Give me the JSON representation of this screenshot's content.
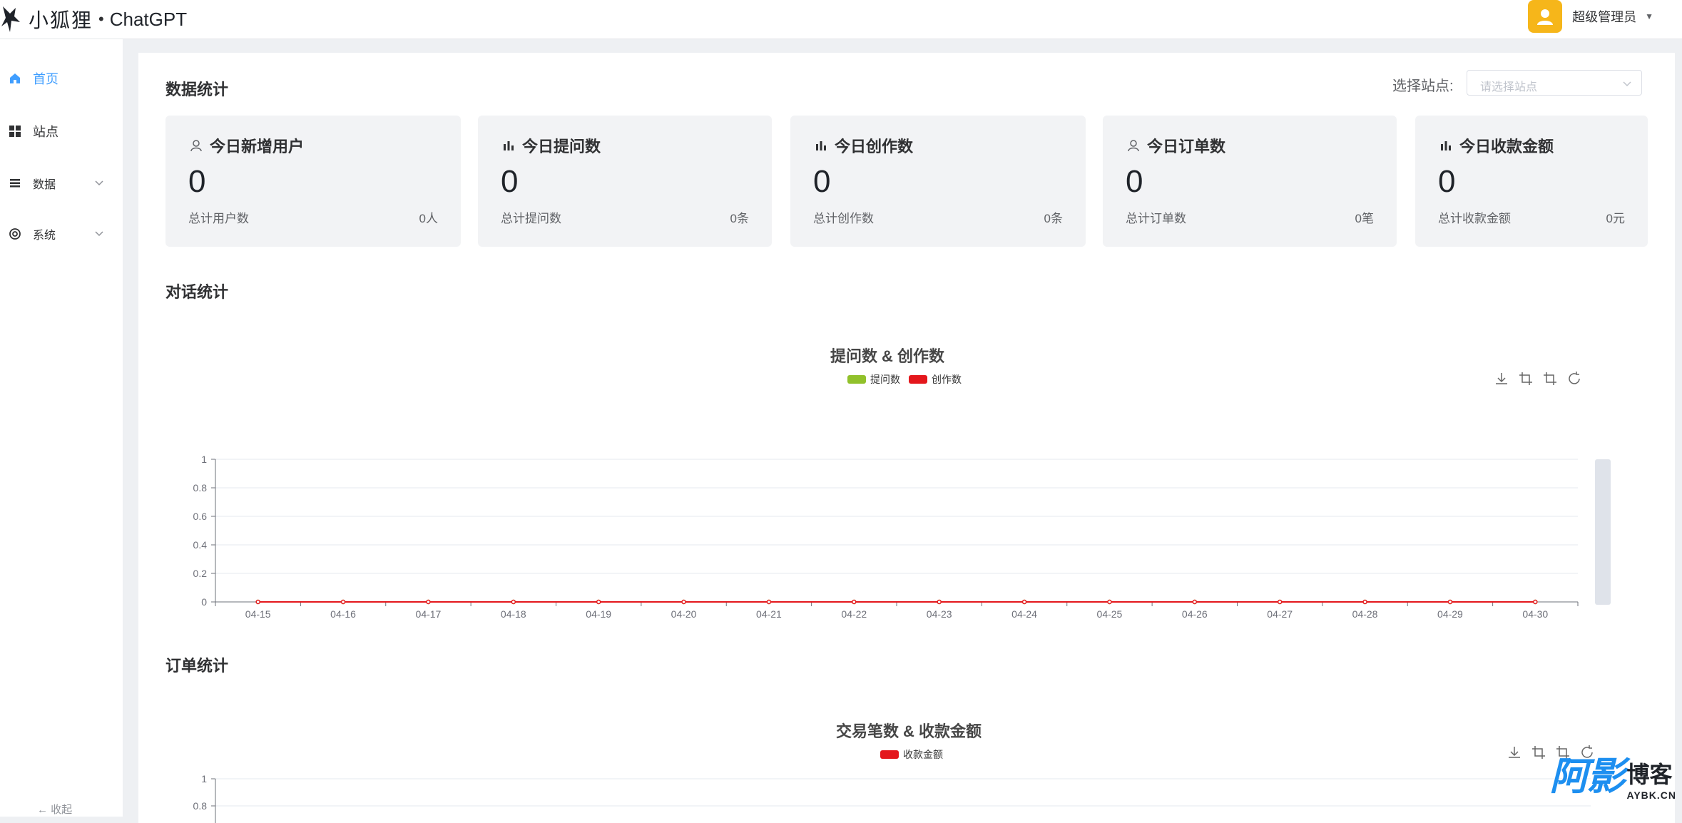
{
  "header": {
    "logo_text": "小狐狸",
    "logo_dot": "•",
    "logo_sub": "ChatGPT",
    "user_name": "超级管理员",
    "user_caret": "▼"
  },
  "sidebar": {
    "items": [
      {
        "label": "首页",
        "icon": "home-icon",
        "active": true
      },
      {
        "label": "站点",
        "icon": "grid-icon",
        "active": false
      },
      {
        "label": "数据",
        "icon": "list-icon",
        "active": false,
        "expandable": true
      },
      {
        "label": "系统",
        "icon": "gear-icon",
        "active": false,
        "expandable": true
      }
    ],
    "collapse_label": "← 收起"
  },
  "main": {
    "stats_title": "数据统计",
    "site_select_label": "选择站点:",
    "site_select_placeholder": "请选择站点",
    "cards": [
      {
        "title": "今日新增用户",
        "icon": "user-icon",
        "value": "0",
        "foot": "总计用户数",
        "total": "0人"
      },
      {
        "title": "今日提问数",
        "icon": "bar-chart-icon",
        "value": "0",
        "foot": "总计提问数",
        "total": "0条"
      },
      {
        "title": "今日创作数",
        "icon": "bar-chart-icon",
        "value": "0",
        "foot": "总计创作数",
        "total": "0条"
      },
      {
        "title": "今日订单数",
        "icon": "user-icon",
        "value": "0",
        "foot": "总计订单数",
        "total": "0笔"
      },
      {
        "title": "今日收款金额",
        "icon": "bar-chart-icon",
        "value": "0",
        "foot": "总计收款金额",
        "total": "0元"
      }
    ],
    "dialog_section_title": "对话统计",
    "order_section_title": "订单统计"
  },
  "accent_colors": {
    "primary": "#409eff",
    "series_green": "#91c12b",
    "series_red": "#e4171c",
    "avatar": "#f6b61a"
  },
  "chart_data": [
    {
      "type": "line",
      "title": "提问数 & 创作数",
      "x": [
        "04-15",
        "04-16",
        "04-17",
        "04-18",
        "04-19",
        "04-20",
        "04-21",
        "04-22",
        "04-23",
        "04-24",
        "04-25",
        "04-26",
        "04-27",
        "04-28",
        "04-29",
        "04-30"
      ],
      "series": [
        {
          "name": "提问数",
          "color": "#91c12b",
          "values": [
            0,
            0,
            0,
            0,
            0,
            0,
            0,
            0,
            0,
            0,
            0,
            0,
            0,
            0,
            0,
            0
          ]
        },
        {
          "name": "创作数",
          "color": "#e4171c",
          "values": [
            0,
            0,
            0,
            0,
            0,
            0,
            0,
            0,
            0,
            0,
            0,
            0,
            0,
            0,
            0,
            0
          ]
        }
      ],
      "y_ticks": [
        "0",
        "0.2",
        "0.4",
        "0.6",
        "0.8",
        "1"
      ],
      "ylim": [
        0,
        1
      ],
      "grid": true,
      "legend": "top-center"
    },
    {
      "type": "line",
      "title": "交易笔数 & 收款金额",
      "series": [
        {
          "name": "收款金额",
          "color": "#e4171c",
          "values": []
        }
      ],
      "y_ticks": [
        "0.8",
        "1"
      ],
      "ylim": [
        0,
        1
      ],
      "grid": true,
      "legend": "top-center"
    }
  ],
  "watermark": {
    "big": "阿影",
    "r1": "博客",
    "r2": "AYBK.CN"
  }
}
